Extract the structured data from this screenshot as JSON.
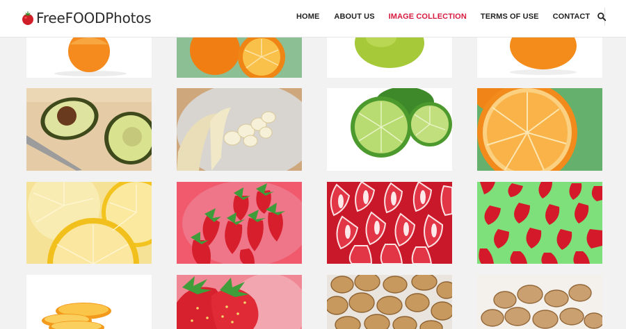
{
  "site": {
    "logo_part1": "Free",
    "logo_part2": "FOOD",
    "logo_part3": "Photos"
  },
  "nav": {
    "items": [
      {
        "label": "HOME",
        "active": false
      },
      {
        "label": "ABOUT US",
        "active": false
      },
      {
        "label": "IMAGE COLLECTION",
        "active": true
      },
      {
        "label": "TERMS OF USE",
        "active": false
      },
      {
        "label": "CONTACT",
        "active": false
      }
    ],
    "search_icon": "search-icon"
  },
  "colors": {
    "accent": "#d6193e",
    "nav_text": "#222222",
    "page_bg": "#f2f2f2"
  },
  "gallery": {
    "photos": [
      {
        "subject": "orange-half"
      },
      {
        "subject": "oranges-on-green"
      },
      {
        "subject": "green-apple"
      },
      {
        "subject": "orange-on-white"
      },
      {
        "subject": "avocado-halves-with-knife"
      },
      {
        "subject": "sliced-banana-on-plate"
      },
      {
        "subject": "lime-halves"
      },
      {
        "subject": "orange-half-on-green"
      },
      {
        "subject": "lemon-slices"
      },
      {
        "subject": "strawberries-on-pink"
      },
      {
        "subject": "strawberry-halves"
      },
      {
        "subject": "strawberries-on-green"
      },
      {
        "subject": "orange-slices"
      },
      {
        "subject": "strawberries-closeup"
      },
      {
        "subject": "walnuts"
      },
      {
        "subject": "walnuts-on-white"
      }
    ]
  }
}
